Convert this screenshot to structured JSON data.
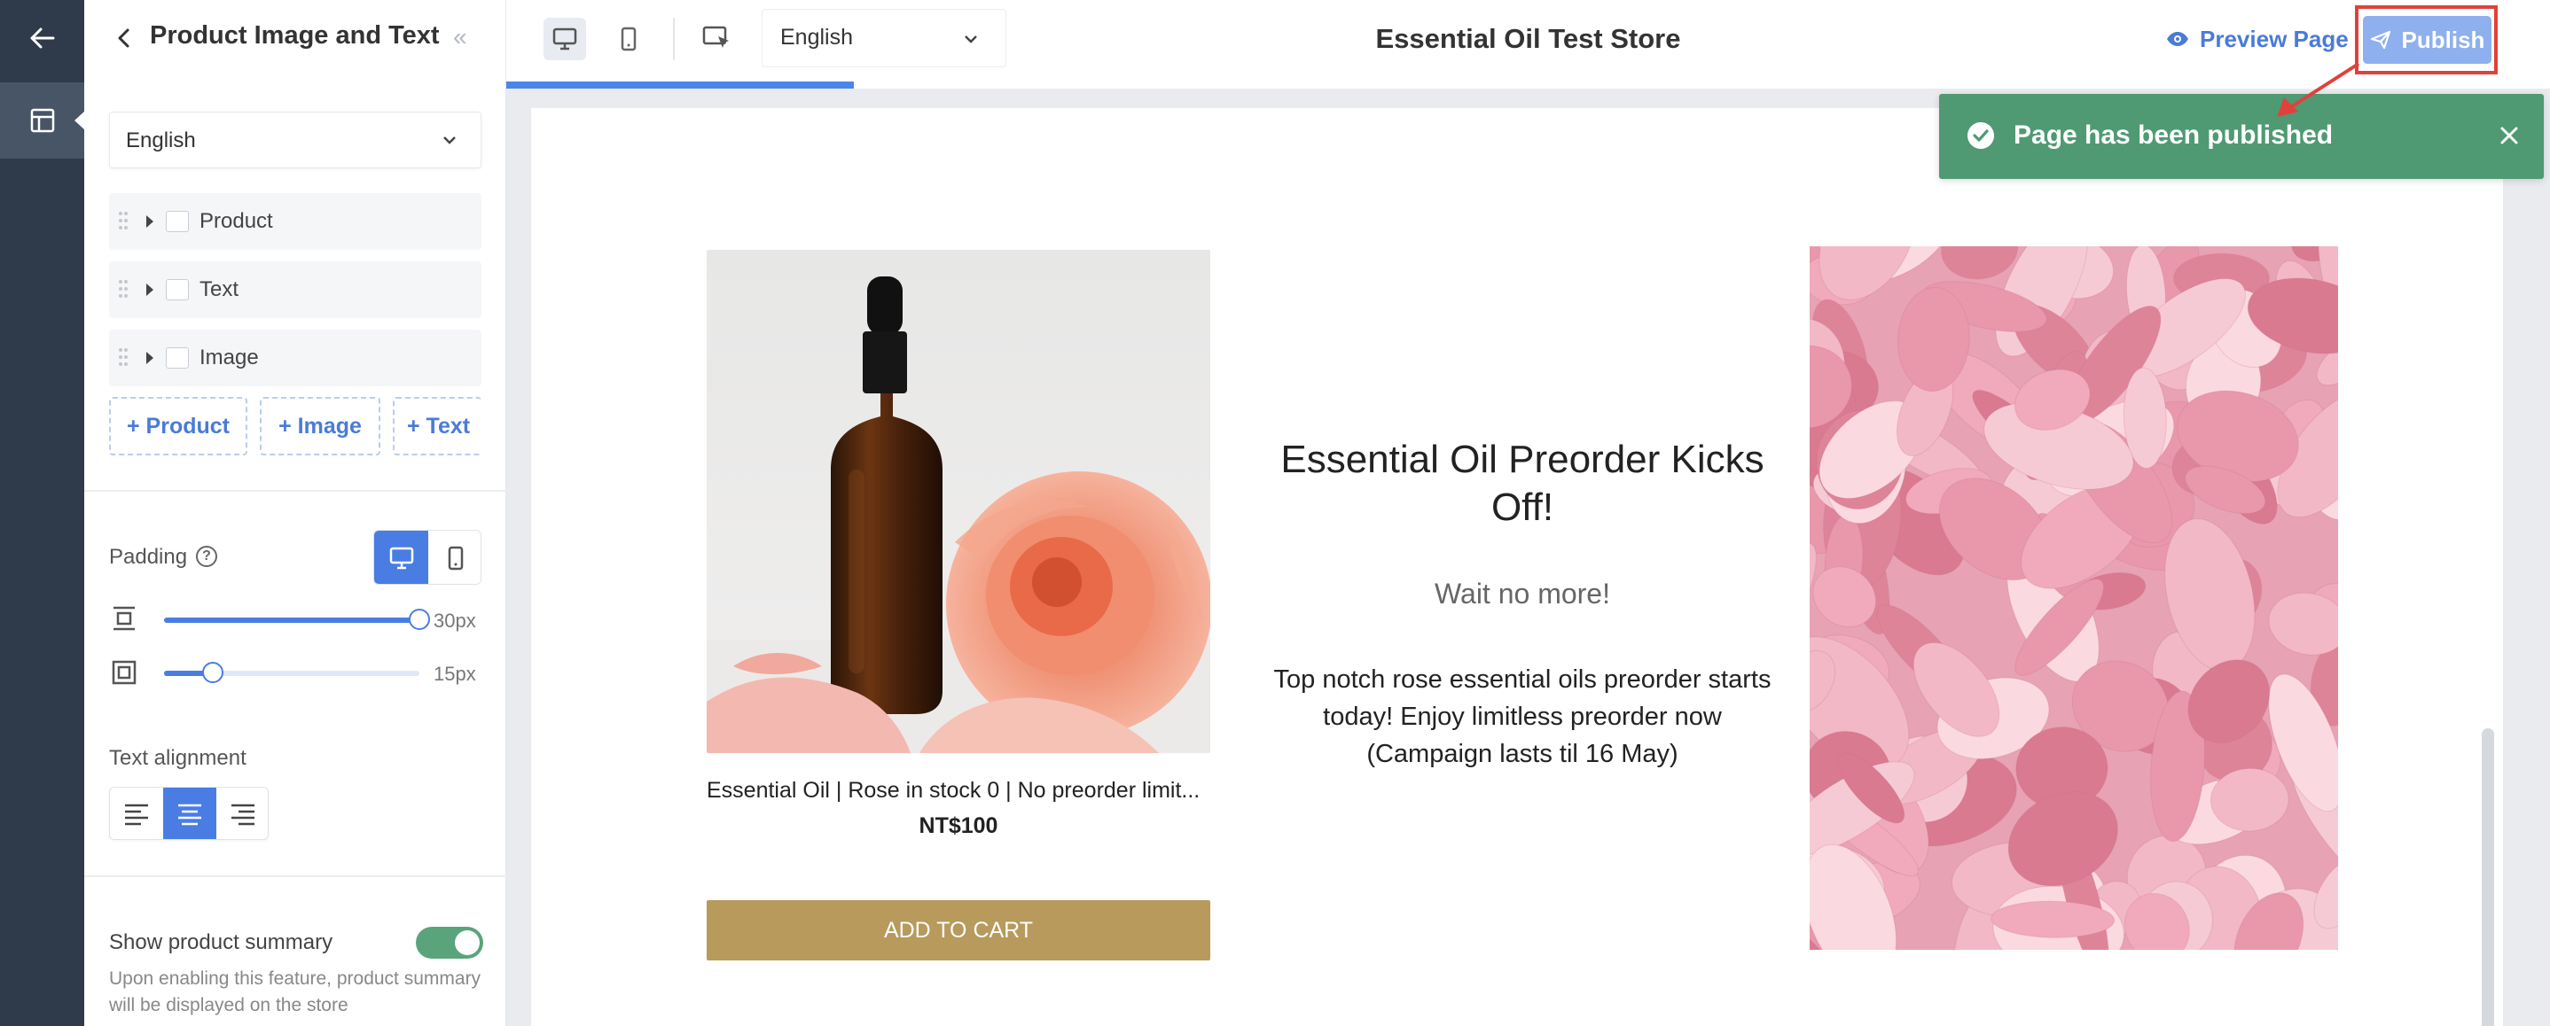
{
  "sidebar_panel": {
    "title": "Product Image and Text",
    "language": "English",
    "blocks": [
      {
        "label": "Product",
        "icon": "bag-icon"
      },
      {
        "label": "Text",
        "icon": "text-icon"
      },
      {
        "label": "Image",
        "icon": "image-icon"
      }
    ],
    "add_buttons": [
      "+ Product",
      "+ Image",
      "+ Text"
    ],
    "padding_label": "Padding",
    "padding_vertical_value": "30px",
    "padding_vertical_level": 1.0,
    "padding_horizontal_value": "15px",
    "padding_horizontal_level": 0.19,
    "text_alignment_label": "Text alignment",
    "text_alignment_selected": "center",
    "show_summary_label": "Show product summary",
    "show_summary_on": true,
    "show_summary_desc": "Upon enabling this feature, product summary will be displayed on the store"
  },
  "topbar": {
    "language": "English",
    "store_name": "Essential Oil Test Store",
    "preview_label": "Preview Page",
    "publish_label": "Publish",
    "progress_fraction": 0.17
  },
  "toast": {
    "message": "Page has been published"
  },
  "preview": {
    "product_name": "Essential Oil | Rose in stock 0 | No preorder limit...",
    "product_price": "NT$100",
    "add_to_cart_label": "ADD TO CART",
    "heading": "Essential Oil Preorder Kicks Off!",
    "subheading": "Wait no more!",
    "body": "Top notch rose essential oils preorder starts today! Enjoy limitless preorder  now (Campaign lasts til 16 May)"
  },
  "colors": {
    "rail": "#2f3a4a",
    "accent": "#4a7de4",
    "toast": "#4f9a73",
    "add_to_cart": "#b79a5c",
    "highlight": "#e0413a"
  }
}
